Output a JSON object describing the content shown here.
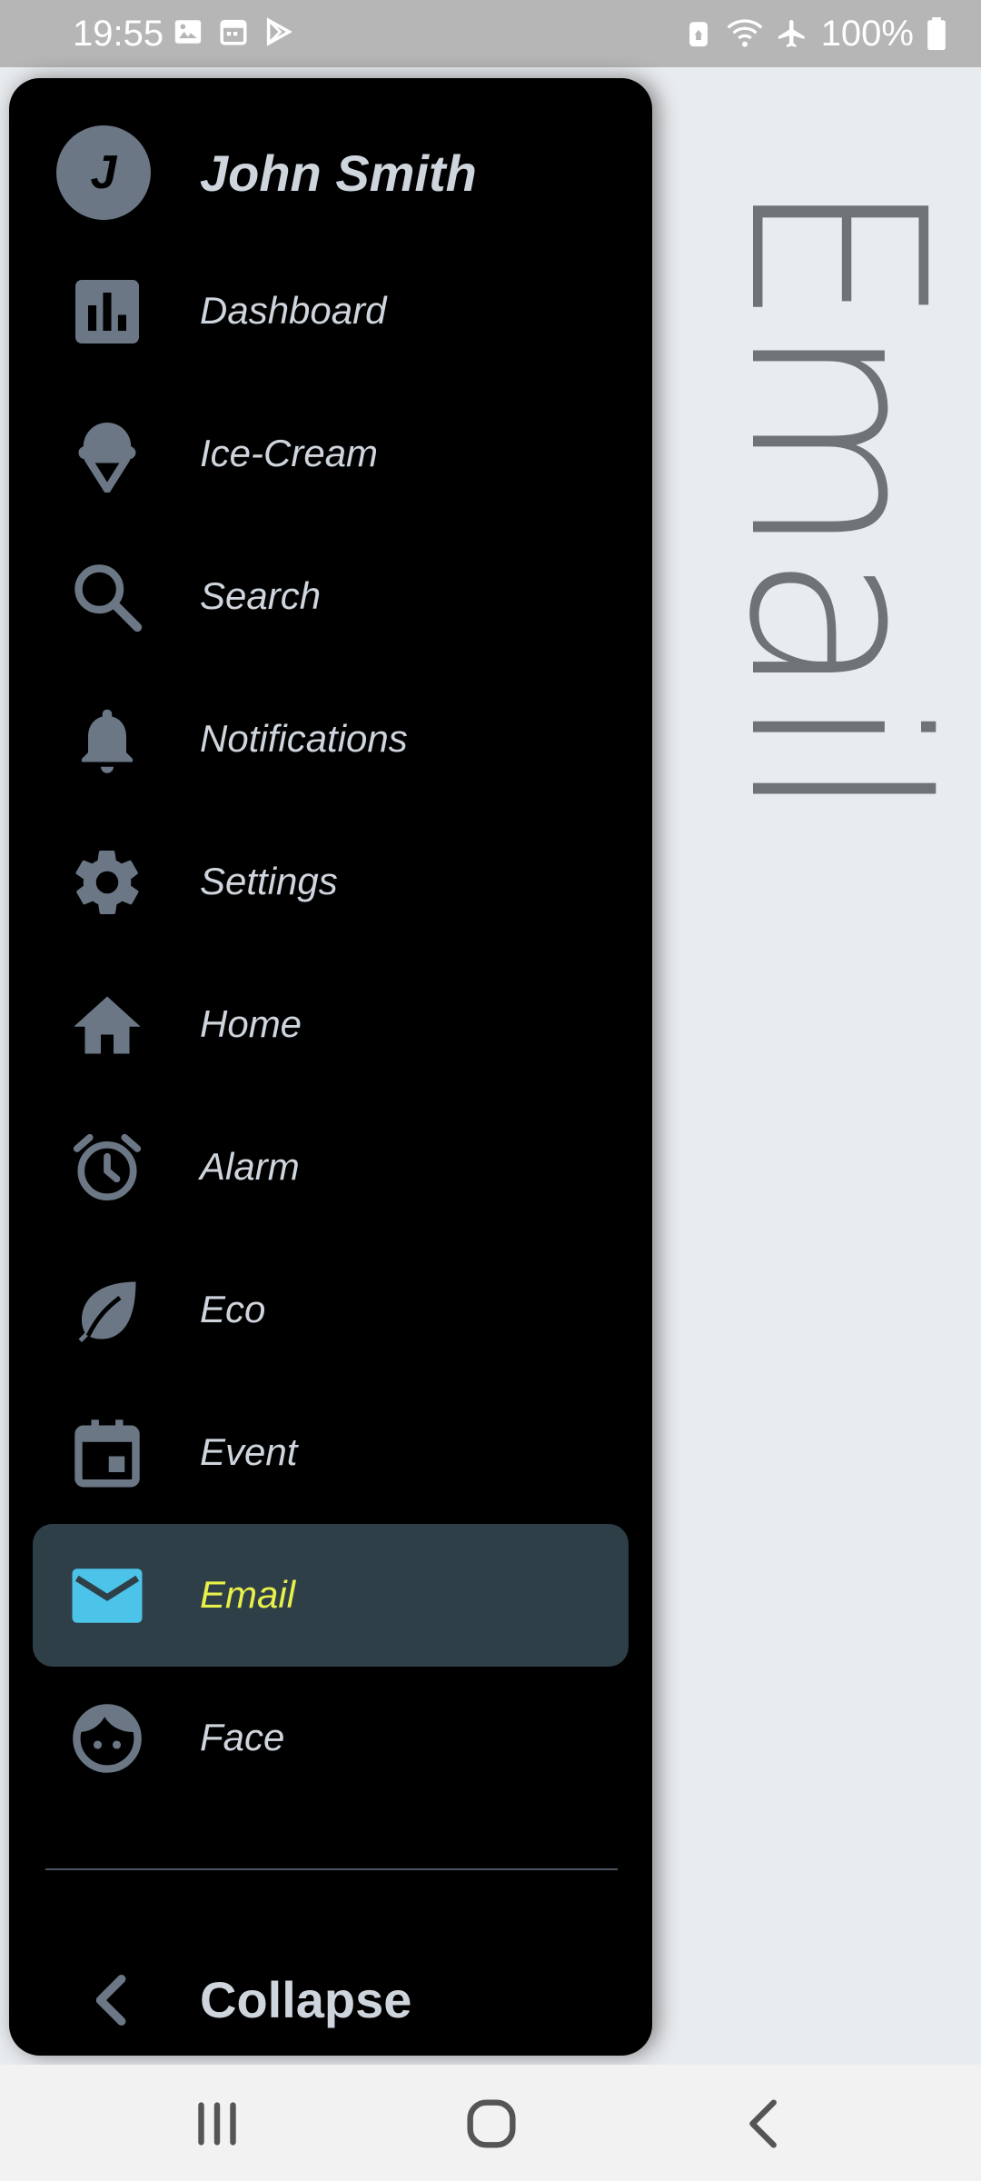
{
  "status_bar": {
    "time": "19:55",
    "left_icons": [
      "image-icon",
      "calendar-icon",
      "play-store-icon"
    ],
    "right_icons": [
      "recycle-icon",
      "wifi-icon",
      "airplane-icon",
      "battery-icon"
    ],
    "battery": "100%"
  },
  "page": {
    "title": "Email"
  },
  "drawer": {
    "user": {
      "initial": "J",
      "name": "John Smith"
    },
    "items": [
      {
        "label": "Dashboard",
        "icon": "bar-chart-icon"
      },
      {
        "label": "Ice-Cream",
        "icon": "ice-cream-icon"
      },
      {
        "label": "Search",
        "icon": "search-icon"
      },
      {
        "label": "Notifications",
        "icon": "bell-icon"
      },
      {
        "label": "Settings",
        "icon": "gear-icon"
      },
      {
        "label": "Home",
        "icon": "home-icon"
      },
      {
        "label": "Alarm",
        "icon": "alarm-icon"
      },
      {
        "label": "Eco",
        "icon": "leaf-icon"
      },
      {
        "label": "Event",
        "icon": "event-icon"
      },
      {
        "label": "Email",
        "icon": "email-icon",
        "active": true
      },
      {
        "label": "Face",
        "icon": "face-icon"
      }
    ],
    "collapse_label": "Collapse"
  },
  "colors": {
    "drawer_bg": "#000000",
    "icon": "#6b7785",
    "active_bg": "#2f3f47",
    "active_text": "#e8f04a",
    "active_icon": "#4cc3e8"
  }
}
